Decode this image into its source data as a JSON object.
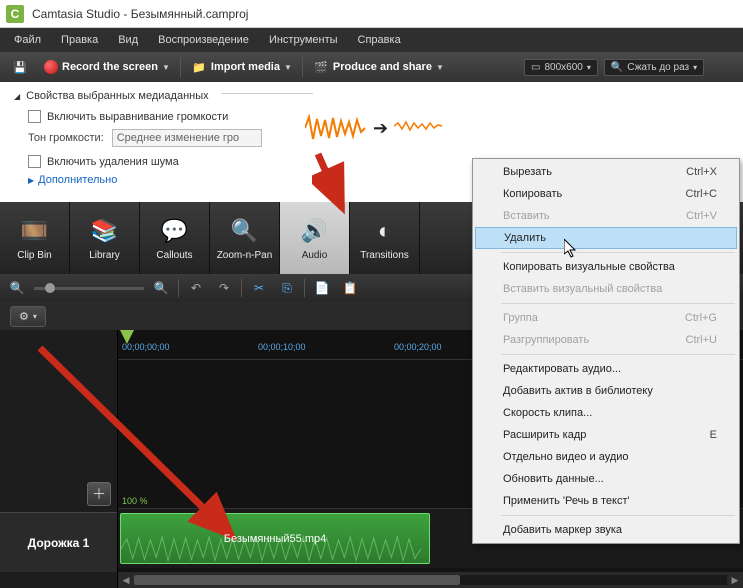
{
  "title": "Camtasia Studio - Безымянный.camproj",
  "app_icon_letter": "C",
  "menubar": [
    "Файл",
    "Правка",
    "Вид",
    "Воспроизведение",
    "Инструменты",
    "Справка"
  ],
  "toolbar": {
    "record": "Record the screen",
    "import": "Import media",
    "produce": "Produce and share"
  },
  "right_toolbar": {
    "dimensions": "800x600",
    "shrink": "Сжать до раз"
  },
  "props": {
    "header": "Свойства выбранных медиаданных",
    "volume_align": "Включить выравнивание громкости",
    "tone_label": "Тон громкости:",
    "tone_value": "Среднее изменение гро",
    "noise": "Включить удаления шума",
    "more": "Дополнительно"
  },
  "tabs": [
    "Clip Bin",
    "Library",
    "Callouts",
    "Zoom-n-Pan",
    "Audio",
    "Transitions"
  ],
  "timeline": {
    "timecodes": [
      "00;00;00;00",
      "00;00;10;00",
      "00;00;20;00"
    ],
    "track_label": "Дорожка 1",
    "percent": "100 %",
    "clip_name": "Безымянный55.mp4"
  },
  "context_menu": {
    "items": [
      {
        "label": "Вырезать",
        "shortcut": "Ctrl+X",
        "enabled": true
      },
      {
        "label": "Копировать",
        "shortcut": "Ctrl+C",
        "enabled": true
      },
      {
        "label": "Вставить",
        "shortcut": "Ctrl+V",
        "enabled": false
      },
      {
        "label": "Удалить",
        "shortcut": "",
        "enabled": true,
        "highlighted": true
      },
      {
        "sep": true
      },
      {
        "label": "Копировать визуальные свойства",
        "shortcut": "",
        "enabled": true
      },
      {
        "label": "Вставить визуальный свойства",
        "shortcut": "",
        "enabled": false
      },
      {
        "sep": true
      },
      {
        "label": "Группа",
        "shortcut": "Ctrl+G",
        "enabled": false
      },
      {
        "label": "Разгруппировать",
        "shortcut": "Ctrl+U",
        "enabled": false
      },
      {
        "sep": true
      },
      {
        "label": "Редактировать аудио...",
        "shortcut": "",
        "enabled": true
      },
      {
        "label": "Добавить актив в библиотеку",
        "shortcut": "",
        "enabled": true
      },
      {
        "label": "Скорость клипа...",
        "shortcut": "",
        "enabled": true
      },
      {
        "label": "Расширить кадр",
        "shortcut": "E",
        "enabled": true
      },
      {
        "label": "Отдельно видео и аудио",
        "shortcut": "",
        "enabled": true
      },
      {
        "label": "Обновить данные...",
        "shortcut": "",
        "enabled": true
      },
      {
        "label": "Применить 'Речь в текст'",
        "shortcut": "",
        "enabled": true
      },
      {
        "sep": true
      },
      {
        "label": "Добавить маркер звука",
        "shortcut": "",
        "enabled": true
      }
    ]
  }
}
